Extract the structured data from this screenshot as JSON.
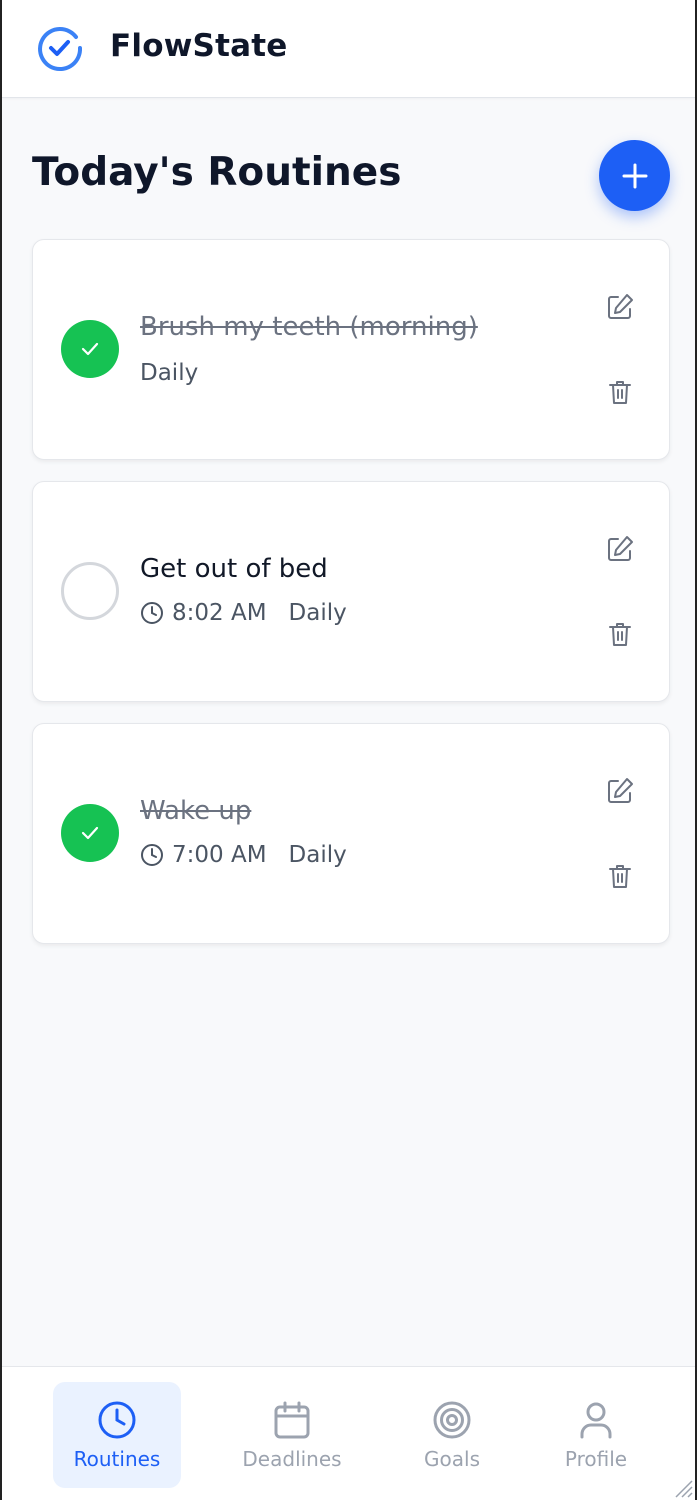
{
  "app": {
    "title": "FlowState",
    "logo_icon": "check-circle-icon",
    "accent_color": "#1d5ff5",
    "success_color": "#16c253"
  },
  "page": {
    "title": "Today's Routines",
    "add_icon": "plus-icon"
  },
  "routines": [
    {
      "title": "Brush my teeth (morning)",
      "completed": true,
      "time": "",
      "frequency": "Daily"
    },
    {
      "title": "Get out of bed",
      "completed": false,
      "time": "8:02 AM",
      "frequency": "Daily"
    },
    {
      "title": "Wake up",
      "completed": true,
      "time": "7:00 AM",
      "frequency": "Daily"
    }
  ],
  "nav": {
    "active": "Routines",
    "tabs": [
      {
        "label": "Routines",
        "icon": "clock-icon"
      },
      {
        "label": "Deadlines",
        "icon": "calendar-icon"
      },
      {
        "label": "Goals",
        "icon": "target-icon"
      },
      {
        "label": "Profile",
        "icon": "user-icon"
      }
    ]
  }
}
